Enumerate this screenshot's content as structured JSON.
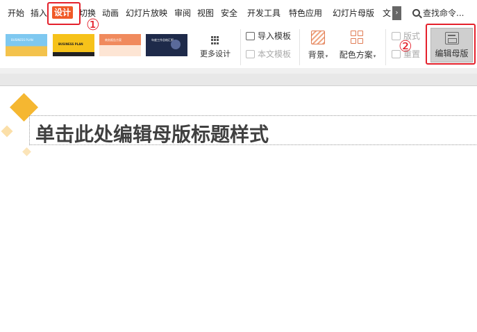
{
  "menu": {
    "items": [
      "开始",
      "插入",
      "设计",
      "切换",
      "动画",
      "幻灯片放映",
      "审阅",
      "视图",
      "安全",
      "开发工具",
      "特色应用",
      "幻灯片母版",
      "文"
    ],
    "more": "›",
    "search_placeholder": "查找命令..."
  },
  "ribbon": {
    "thumbnails": [
      {
        "text": "BUSINESS PLAN"
      },
      {
        "text": "BUSINESS PLAN"
      },
      {
        "text": "商务报告方案"
      },
      {
        "text": "年度工作总结汇报"
      }
    ],
    "more_designs": "更多设计",
    "import_template": "导入模板",
    "this_template": "本文模板",
    "background": "背景",
    "color_scheme": "配色方案",
    "layout": "版式",
    "rearrange": "重置",
    "edit_master": "编辑母版"
  },
  "annotations": {
    "step1": "①",
    "step2": "②"
  },
  "slide": {
    "title_placeholder": "单击此处编辑母版标题样式"
  },
  "colors": {
    "accent_red": "#e4202b",
    "active_tab": "#f05a28",
    "diamond": "#f5b731"
  }
}
